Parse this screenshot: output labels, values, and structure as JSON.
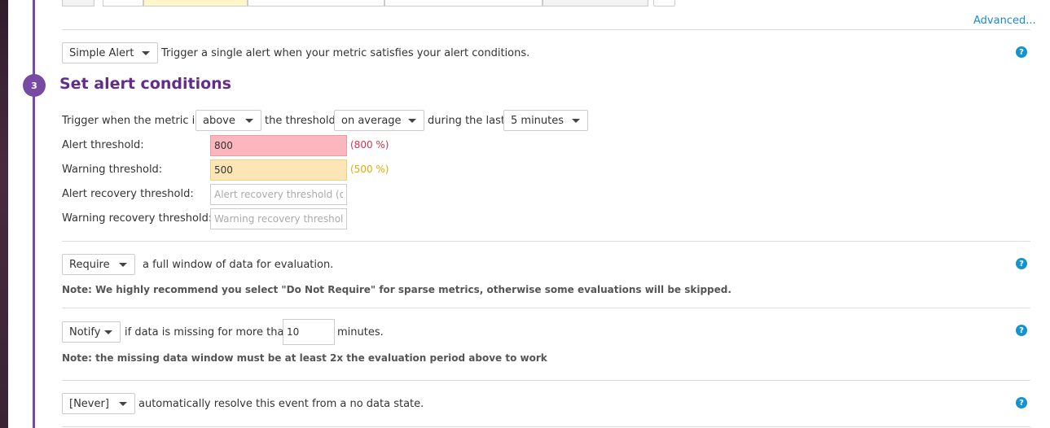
{
  "header": {
    "advanced_link": "Advanced..."
  },
  "alert_type": {
    "selected": "Simple Alert",
    "description": "Trigger a single alert when your metric satisfies your alert conditions."
  },
  "step": {
    "number": "3",
    "title": "Set alert conditions"
  },
  "trigger": {
    "prefix": "Trigger when the metric is",
    "comparator": "above",
    "mid": "the threshold",
    "aggregation": "on average",
    "during": "during the last",
    "window": "5 minutes"
  },
  "thresholds": {
    "alert_label": "Alert threshold:",
    "alert_value": "800",
    "alert_pct": "(800 %)",
    "warning_label": "Warning threshold:",
    "warning_value": "500",
    "warning_pct": "(500 %)",
    "alert_recovery_label": "Alert recovery threshold:",
    "alert_recovery_placeholder": "Alert recovery threshold (optional)",
    "warning_recovery_label": "Warning recovery threshold:",
    "warning_recovery_placeholder": "Warning recovery threshold (optional)"
  },
  "window_req": {
    "selected": "Require",
    "text": "a full window of data for evaluation.",
    "note": "Note: We highly recommend you select \"Do Not Require\" for sparse metrics, otherwise some evaluations will be skipped."
  },
  "missing_data": {
    "selected": "Notify",
    "text": "if data is missing for more than",
    "minutes_value": "10",
    "unit": "minutes.",
    "note": "Note: the missing data window must be at least 2x the evaluation period above to work"
  },
  "auto_resolve": {
    "selected": "[Never]",
    "text": "automatically resolve this event from a no data state."
  },
  "icons": {
    "help": "?"
  },
  "colors": {
    "accent": "#774aa4",
    "title": "#632d8a",
    "link": "#1a8ad0",
    "alert_bg": "#fbb6be",
    "warn_bg": "#fde6b5",
    "help": "#1494cc"
  }
}
